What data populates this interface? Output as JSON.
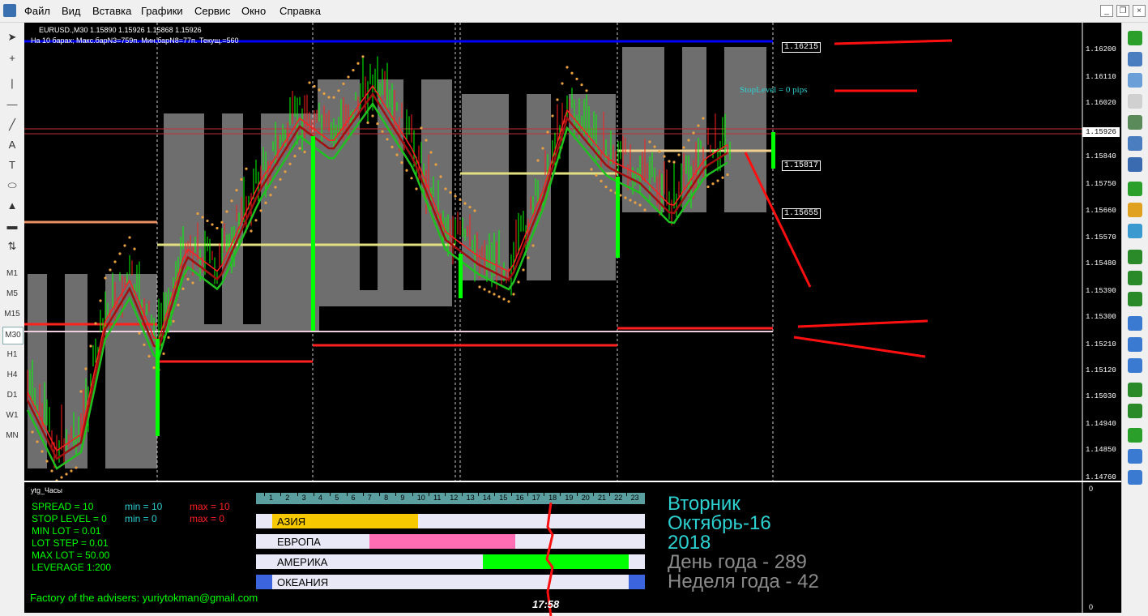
{
  "menu": {
    "items": [
      "Файл",
      "Вид",
      "Вставка",
      "Графики",
      "Сервис",
      "Окно",
      "Справка"
    ]
  },
  "left_toolbar": {
    "tools": [
      "cursor-icon",
      "crosshair-icon",
      "vertical-line-icon",
      "horizontal-line-icon",
      "trendline-icon",
      "text-icon",
      "text-label-icon",
      "ellipse-icon",
      "triangle-icon",
      "rectangle-icon",
      "arrows-icon"
    ],
    "timeframes": [
      "M1",
      "M5",
      "M15",
      "M30",
      "H1",
      "H4",
      "D1",
      "W1",
      "MN"
    ],
    "active_timeframe": "M30"
  },
  "chart": {
    "header": "EURUSD.,M30  1.15890 1.15926 1.15868 1.15926",
    "info": "На 10 барах; Макс.барN3=759п. Мин.барN8=77п. Текущ.=560",
    "stoplevel_text": "StopLevel = 0 pips",
    "current_price": "1.15926",
    "box_labels": [
      "1.16215",
      "1.15817",
      "1.15655"
    ],
    "price_axis": [
      "1.16200",
      "1.16110",
      "1.16020",
      "1.15930",
      "1.15840",
      "1.15750",
      "1.15660",
      "1.15570",
      "1.15480",
      "1.15390",
      "1.15300",
      "1.15210",
      "1.15120",
      "1.15030",
      "1.14940",
      "1.14850",
      "1.14760"
    ],
    "colors": {
      "bull": "#00ff00",
      "bear": "#ff0000",
      "sar": "#e8a040",
      "box": "#7a7a7a",
      "level_blue": "#0000ff"
    }
  },
  "indicator_panel": {
    "name": "ytg_Часы",
    "spread": "SPREAD = 10",
    "spread_min": "min = 10",
    "spread_max": "max = 10",
    "stop_level": "STOP LEVEL = 0",
    "stop_min": "min = 0",
    "stop_max": "max = 0",
    "min_lot": "MIN LOT = 0.01",
    "lot_step": "LOT STEP = 0.01",
    "max_lot": "MAX LOT = 50.00",
    "leverage": "LEVERAGE 1:200",
    "footer": "Factory of the advisers: yuriytokman@gmail.com",
    "axis_zero": "0",
    "hours": [
      "1",
      "2",
      "3",
      "4",
      "5",
      "6",
      "7",
      "8",
      "9",
      "10",
      "11",
      "12",
      "13",
      "14",
      "15",
      "16",
      "17",
      "18",
      "19",
      "20",
      "21",
      "22",
      "23"
    ],
    "sessions": [
      {
        "name": "АЗИЯ",
        "color": "#f5c800"
      },
      {
        "name": "ЕВРОПА",
        "color": "#ff6eb4"
      },
      {
        "name": "АМЕРИКА",
        "color": "#00ff00"
      },
      {
        "name": "ОКЕАНИЯ",
        "color": "#3c64dc"
      }
    ],
    "clock": "17:58",
    "weekday": "Вторник",
    "date": "Октябрь-16",
    "year": "2018",
    "day_of_year": "День года - 289",
    "week_of_year": "Неделя года - 42"
  }
}
